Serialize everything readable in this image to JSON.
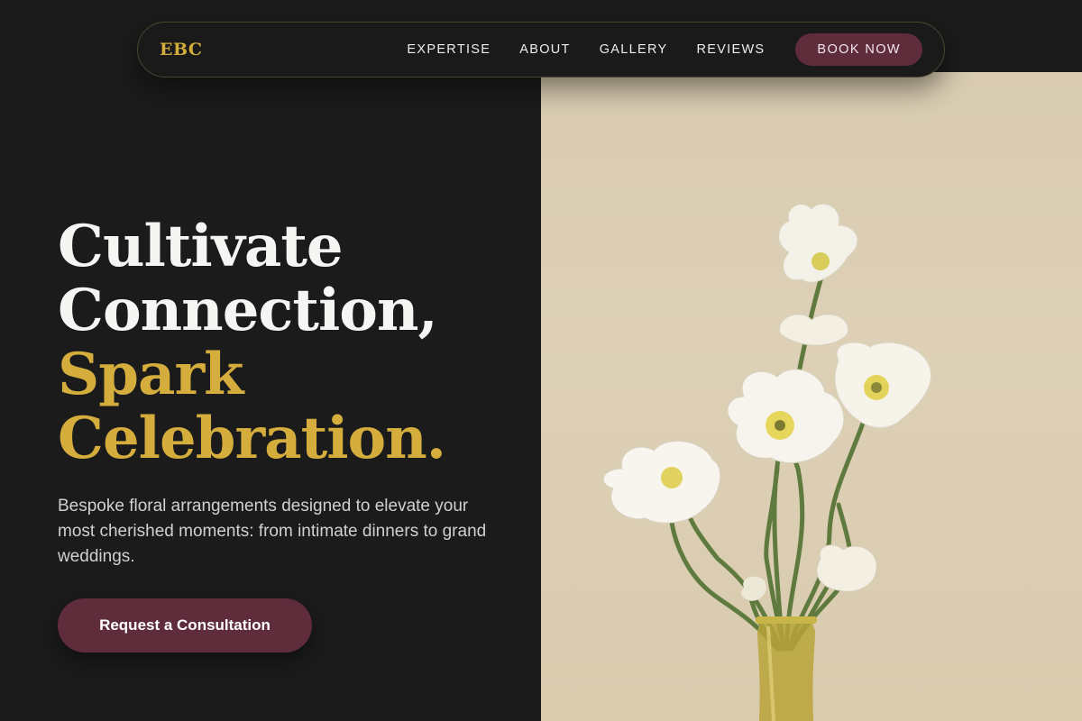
{
  "brand": {
    "logo": "EBC",
    "accent": "#d4ad3d",
    "cta_color": "#5e2c3b"
  },
  "nav": {
    "links": [
      "EXPERTISE",
      "ABOUT",
      "GALLERY",
      "REVIEWS"
    ],
    "book_label": "BOOK NOW"
  },
  "hero": {
    "headline_line1": "Cultivate",
    "headline_line2": "Connection,",
    "headline_line3": "Spark",
    "headline_line4": "Celebration.",
    "lead": "Bespoke floral arrangements designed to elevate your most cherished moments: from intimate dinners to grand weddings.",
    "cta_label": "Request a Consultation"
  }
}
